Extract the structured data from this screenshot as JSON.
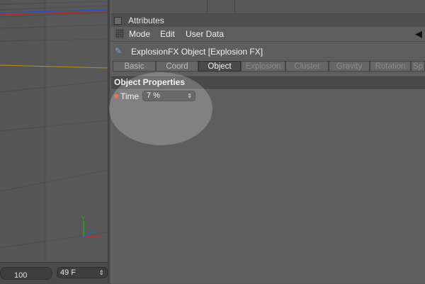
{
  "timeline": {
    "ruler_value": "100",
    "frame_value": "49 F",
    "frame_arrow": "⇕"
  },
  "attributes": {
    "title": "Attributes",
    "menu": [
      "Mode",
      "Edit",
      "User Data"
    ],
    "object_name": "ExplosionFX Object [Explosion FX]",
    "tabs": [
      "Basic",
      "Coord",
      "Object",
      "Explosion",
      "Cluster",
      "Gravity",
      "Rotation",
      "Sp"
    ],
    "active_tab": "Object",
    "section_title": "Object Properties",
    "param_label": "Time",
    "param_value": "7 %",
    "param_spin": "⇕"
  },
  "icons": {
    "back": "back-arrow-icon",
    "object": "explosion-object-icon",
    "keyframe": "keyframe-dot-icon"
  },
  "colors": {
    "keyframe_dot": "#e8501e",
    "panel_bg": "#5e5e5e",
    "axis_y": "#19b019",
    "axis_x": "#d22222",
    "axis_z": "#2a5bd6"
  }
}
